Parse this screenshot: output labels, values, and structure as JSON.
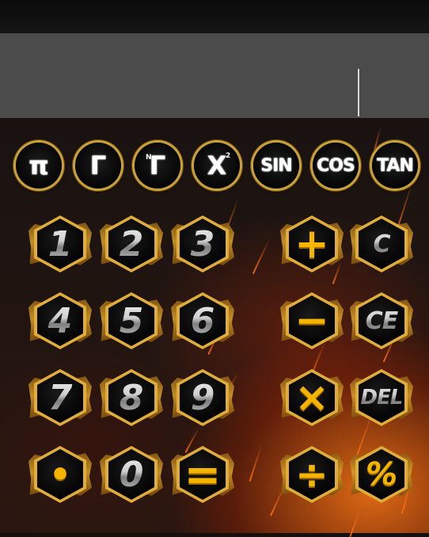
{
  "display": {
    "value": ""
  },
  "functions": [
    {
      "name": "pi",
      "label": "π"
    },
    {
      "name": "gamma",
      "label": "Γ"
    },
    {
      "name": "nth-gamma",
      "label": "Γ",
      "sup": "N"
    },
    {
      "name": "x-squared",
      "label": "X",
      "sup": "2"
    },
    {
      "name": "sin",
      "label": "SIN"
    },
    {
      "name": "cos",
      "label": "COS"
    },
    {
      "name": "tan",
      "label": "TAN"
    }
  ],
  "digits": {
    "one": "1",
    "two": "2",
    "three": "3",
    "four": "4",
    "five": "5",
    "six": "6",
    "seven": "7",
    "eight": "8",
    "nine": "9",
    "zero": "0"
  },
  "operators": {
    "plus": "+",
    "minus": "−",
    "multiply": "×",
    "divide": "÷",
    "equals": "=",
    "dot": "•",
    "percent": "%"
  },
  "controls": {
    "clear": "C",
    "clear_entry": "CE",
    "delete": "DEL"
  },
  "colors": {
    "gold": "#f4b400",
    "rim": "#e0ad3a",
    "display_bg": "#4b4b4b"
  }
}
